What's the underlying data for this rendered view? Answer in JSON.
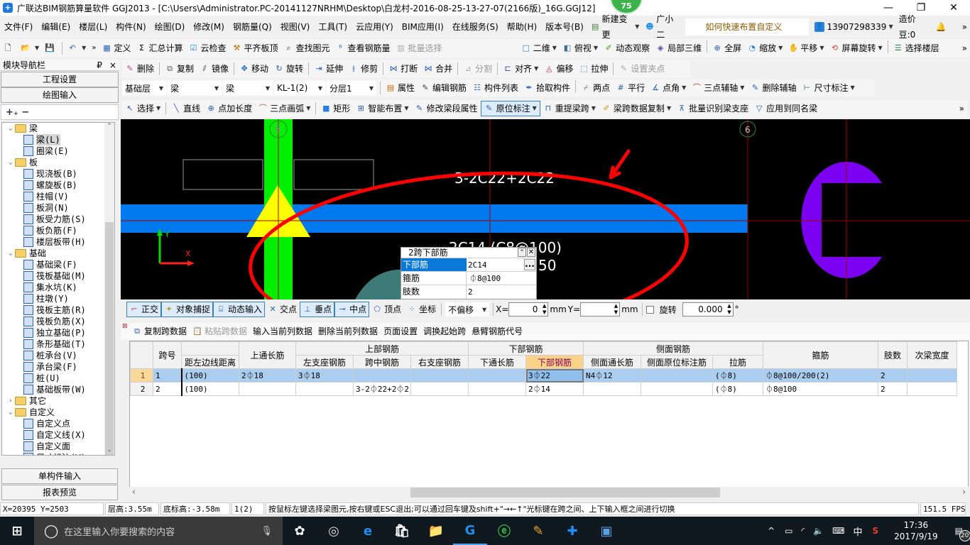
{
  "window": {
    "app_icon": "guanglianda-logo-icon",
    "title": "广联达BIM钢筋算量软件 GGJ2013 - [C:\\Users\\Administrator.PC-20141127NRHM\\Desktop\\白龙村-2016-08-25-13-27-07(2166版)_16G.GGJ12]",
    "badge": "75",
    "minimize": "—",
    "restore": "❐",
    "close": "✕"
  },
  "menubar": {
    "items": [
      "文件(F)",
      "编辑(E)",
      "楼层(L)",
      "构件(N)",
      "绘图(D)",
      "修改(M)",
      "钢筋量(Q)",
      "视图(V)",
      "工具(T)",
      "云应用(Y)",
      "BIM应用(I)",
      "在线服务(S)",
      "帮助(H)",
      "版本号(B)"
    ],
    "new_change": "新建变更",
    "assistant": "广小二",
    "hint": "如何快速布置自定义范..",
    "account": "13907298339",
    "beans": "造价豆:0",
    "more": "»"
  },
  "toolbar1": {
    "left_items": [
      "定义",
      "汇总计算",
      "云检查",
      "平齐板顶",
      "查找图元",
      "查看钢筋量",
      "批量选择"
    ],
    "right_items": [
      "二维",
      "俯视",
      "动态观察",
      "局部三维",
      "全屏",
      "缩放",
      "平移",
      "屏幕旋转",
      "选择楼层"
    ],
    "more": "»"
  },
  "toolbar2": {
    "items": [
      "删除",
      "复制",
      "镜像",
      "移动",
      "旋转",
      "延伸",
      "修剪",
      "打断",
      "合并",
      "分割",
      "对齐",
      "偏移",
      "拉伸",
      "设置夹点"
    ]
  },
  "toolbar3": {
    "floor": "基础层",
    "type1": "梁",
    "type2": "梁",
    "component": "KL-1(2)",
    "layer": "分层1",
    "items": [
      "属性",
      "编辑钢筋",
      "构件列表",
      "拾取构件",
      "两点",
      "平行",
      "点角",
      "三点辅轴",
      "删除辅轴",
      "尺寸标注"
    ]
  },
  "toolbar4": {
    "items": [
      "选择",
      "直线",
      "点加长度",
      "三点画弧",
      "矩形",
      "智能布置",
      "修改梁段属性",
      "原位标注",
      "重提梁跨",
      "梁跨数据复制",
      "批量识别梁支座",
      "应用到同名梁"
    ],
    "active": "原位标注",
    "more": "»"
  },
  "nav": {
    "title": "模块导航栏",
    "pin": "₽",
    "close": "×",
    "buttons": [
      "工程设置",
      "绘图输入"
    ],
    "expand_collapse": "+ −",
    "tree": [
      {
        "level": 0,
        "label": "梁",
        "type": "folder",
        "expanded": true
      },
      {
        "level": 1,
        "label": "梁(L)",
        "type": "item",
        "selected": true
      },
      {
        "level": 1,
        "label": "圈梁(E)",
        "type": "item"
      },
      {
        "level": 0,
        "label": "板",
        "type": "folder",
        "expanded": true
      },
      {
        "level": 1,
        "label": "现浇板(B)",
        "type": "item"
      },
      {
        "level": 1,
        "label": "螺旋板(B)",
        "type": "item"
      },
      {
        "level": 1,
        "label": "柱帽(V)",
        "type": "item"
      },
      {
        "level": 1,
        "label": "板洞(N)",
        "type": "item"
      },
      {
        "level": 1,
        "label": "板受力筋(S)",
        "type": "item"
      },
      {
        "level": 1,
        "label": "板负筋(F)",
        "type": "item"
      },
      {
        "level": 1,
        "label": "楼层板带(H)",
        "type": "item"
      },
      {
        "level": 0,
        "label": "基础",
        "type": "folder",
        "expanded": true
      },
      {
        "level": 1,
        "label": "基础梁(F)",
        "type": "item"
      },
      {
        "level": 1,
        "label": "筏板基础(M)",
        "type": "item"
      },
      {
        "level": 1,
        "label": "集水坑(K)",
        "type": "item"
      },
      {
        "level": 1,
        "label": "柱墩(Y)",
        "type": "item"
      },
      {
        "level": 1,
        "label": "筏板主筋(R)",
        "type": "item"
      },
      {
        "level": 1,
        "label": "筏板负筋(X)",
        "type": "item"
      },
      {
        "level": 1,
        "label": "独立基础(P)",
        "type": "item"
      },
      {
        "level": 1,
        "label": "条形基础(T)",
        "type": "item"
      },
      {
        "level": 1,
        "label": "桩承台(V)",
        "type": "item"
      },
      {
        "level": 1,
        "label": "承台梁(F)",
        "type": "item"
      },
      {
        "level": 1,
        "label": "桩(U)",
        "type": "item"
      },
      {
        "level": 1,
        "label": "基础板带(W)",
        "type": "item"
      },
      {
        "level": 0,
        "label": "其它",
        "type": "folder",
        "expanded": false
      },
      {
        "level": 0,
        "label": "自定义",
        "type": "folder",
        "expanded": true
      },
      {
        "level": 1,
        "label": "自定义点",
        "type": "item"
      },
      {
        "level": 1,
        "label": "自定义线(X)",
        "type": "item"
      },
      {
        "level": 1,
        "label": "自定义面",
        "type": "item"
      },
      {
        "level": 1,
        "label": "尺寸标注(W)",
        "type": "item"
      }
    ],
    "bottom_buttons": [
      "单构件输入",
      "报表预览"
    ]
  },
  "canvas": {
    "axis5": "5",
    "axis6": "6",
    "top_label": "3-2C22+2C22",
    "bottom_label": "2C14 (C8@100)",
    "bottom_label2": "50",
    "axis_x": "X",
    "axis_y": "Y",
    "colors": {
      "beam": "#0078ee",
      "column": "#00ee00",
      "support": "#ffff00",
      "annotation": "#ff0000",
      "circle_column": "#7b00f0",
      "teal": "#3e7a78"
    }
  },
  "popup": {
    "title": "2跨下部筋",
    "rows": [
      {
        "label": "下部筋",
        "value": "2C14"
      },
      {
        "label": "箍筋",
        "value": "⏀8@100"
      },
      {
        "label": "肢数",
        "value": "2"
      }
    ],
    "more_btn": "..."
  },
  "snapbar": {
    "items": [
      "正交",
      "对象捕捉",
      "动态输入",
      "交点",
      "垂点",
      "中点",
      "顶点",
      "坐标"
    ],
    "offset": "不偏移",
    "x_label": "X=",
    "x_value": "0",
    "y_label": "Y=",
    "y_value": "",
    "unit": "mm",
    "rotate_label": "旋转",
    "rotate_value": "0.000",
    "degree": "°"
  },
  "grid_toolbar": {
    "items": [
      "复制跨数据",
      "粘贴跨数据",
      "输入当前列数据",
      "删除当前列数据",
      "页面设置",
      "调换起始跨",
      "悬臂钢筋代号"
    ]
  },
  "grid": {
    "group_headers": {
      "top": "上部钢筋",
      "bottom": "下部钢筋",
      "side": "侧面钢筋"
    },
    "headers": [
      "跨号",
      "距左边线距离",
      "上通长筋",
      "左支座钢筋",
      "跨中钢筋",
      "右支座钢筋",
      "下通长筋",
      "下部钢筋",
      "侧面通长筋",
      "侧面原位标注筋",
      "拉筋",
      "箍筋",
      "肢数",
      "次梁宽度"
    ],
    "rows": [
      {
        "rn": "1",
        "span": "1",
        "dist": "(100)",
        "top_through": "2⏀18",
        "left_support": "3⏀18",
        "mid": "",
        "right_support": "",
        "bottom_through": "",
        "bottom": "3⏀22",
        "side_through": "N4⏀12",
        "side_mark": "",
        "tie": "(⏀8)",
        "stirrup": "⏀8@100/200(2)",
        "legs": "2",
        "sec_width": ""
      },
      {
        "rn": "2",
        "span": "2",
        "dist": "(100)",
        "top_through": "",
        "left_support": "",
        "mid": "3-2⏀22+2⏀2",
        "right_support": "",
        "bottom_through": "",
        "bottom": "2⏀14",
        "side_through": "",
        "side_mark": "",
        "tie": "(⏀8)",
        "stirrup": "⏀8@100",
        "legs": "2",
        "sec_width": ""
      }
    ]
  },
  "status": {
    "coords": "X=20395 Y=2503",
    "floor_height": "层高:3.55m",
    "bottom_elev": "底标高:-3.58m",
    "span": "1(2)",
    "message": "按鼠标左键选择梁图元,按右键或ESC退出;可以通过回车键及shift+\"→←↑\"光标键在跨之间、上下输入框之间进行切换",
    "fps": "151.5 FPS"
  },
  "taskbar": {
    "search_placeholder": "在这里输入你要搜索的内容",
    "time": "17:36",
    "date": "2017/9/19",
    "ime": "中",
    "notifications": "20"
  }
}
